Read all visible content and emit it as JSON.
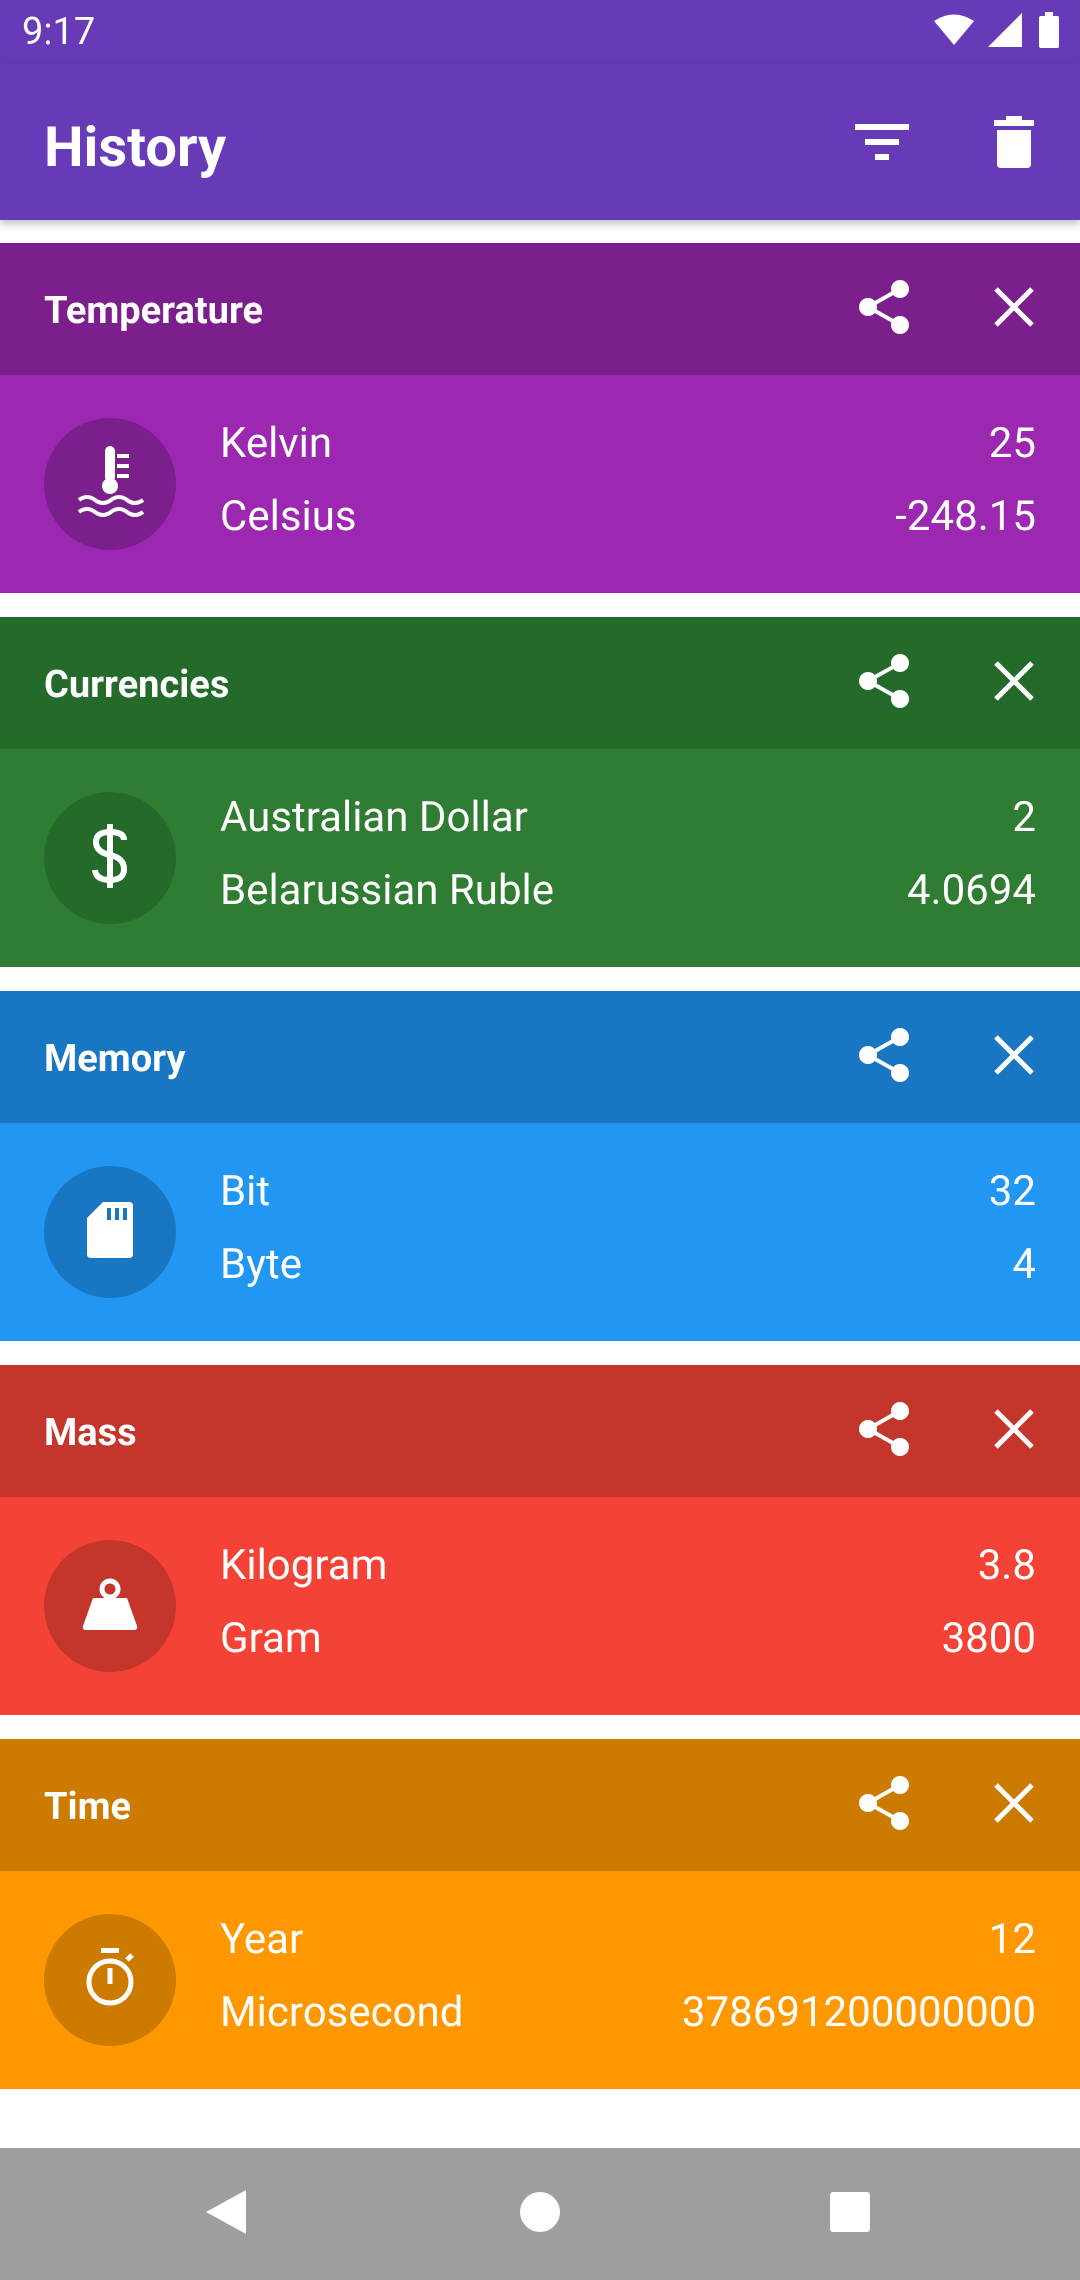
{
  "status_bar": {
    "time": "9:17"
  },
  "app_bar": {
    "title": "History"
  },
  "cards": [
    {
      "category": "Temperature",
      "icon": "thermometer-water-icon",
      "header_color": "#7b1f8c",
      "body_color": "#9c27b0",
      "circle_color": "#7b1f8c",
      "from_unit": "Kelvin",
      "from_value": "25",
      "to_unit": "Celsius",
      "to_value": "-248.15"
    },
    {
      "category": "Currencies",
      "icon": "dollar-icon",
      "header_color": "#246a2b",
      "body_color": "#2e7d32",
      "circle_color": "#246a2b",
      "from_unit": "Australian Dollar",
      "from_value": "2",
      "to_unit": "Belarussian Ruble",
      "to_value": "4.0694"
    },
    {
      "category": "Memory",
      "icon": "sd-card-icon",
      "header_color": "#1976c3",
      "body_color": "#2196f3",
      "circle_color": "#1976c3",
      "from_unit": "Bit",
      "from_value": "32",
      "to_unit": "Byte",
      "to_value": "4"
    },
    {
      "category": "Mass",
      "icon": "weight-icon",
      "header_color": "#c4352b",
      "body_color": "#f44336",
      "circle_color": "#c4352b",
      "from_unit": "Kilogram",
      "from_value": "3.8",
      "to_unit": "Gram",
      "to_value": "3800"
    },
    {
      "category": "Time",
      "icon": "stopwatch-icon",
      "header_color": "#cc7a00",
      "body_color": "#ff9800",
      "circle_color": "#cc7a00",
      "from_unit": "Year",
      "from_value": "12",
      "to_unit": "Microsecond",
      "to_value": "378691200000000"
    }
  ]
}
